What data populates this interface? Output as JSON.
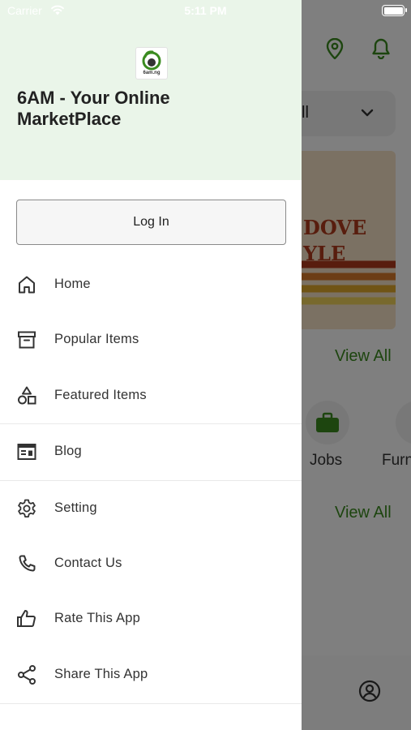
{
  "status_bar": {
    "carrier": "Carrier",
    "time": "5:11 PM"
  },
  "drawer": {
    "logo_text": "6am.ng",
    "title": "6AM - Your Online MarketPlace",
    "login_label": "Log In",
    "menu": [
      {
        "label": "Home",
        "icon": "home-icon"
      },
      {
        "label": "Popular Items",
        "icon": "archive-box-icon"
      },
      {
        "label": "Featured Items",
        "icon": "shapes-icon"
      },
      {
        "label": "Blog",
        "icon": "newspaper-icon"
      },
      {
        "label": "Setting",
        "icon": "gear-icon"
      },
      {
        "label": "Contact Us",
        "icon": "phone-icon"
      },
      {
        "label": "Rate This App",
        "icon": "thumbs-up-icon"
      },
      {
        "label": "Share This App",
        "icon": "share-icon"
      }
    ]
  },
  "background": {
    "select_value": "ll",
    "banner_lines": [
      "DOVE",
      "YLE"
    ],
    "view_all_label_1": "View All",
    "view_all_label_2": "View All",
    "categories": [
      "Jobs",
      "Furn"
    ]
  },
  "colors": {
    "accent_green": "#3a8b1f",
    "header_bg": "#eaf5e9",
    "overlay": "rgba(0,0,0,0.5)"
  }
}
